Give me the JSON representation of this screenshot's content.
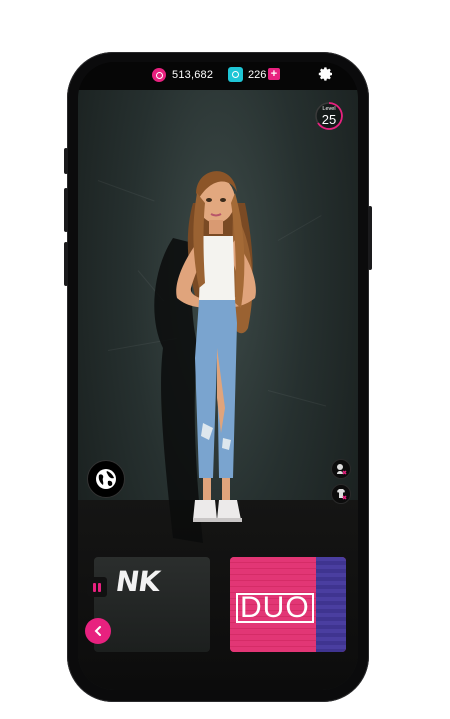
{
  "topbar": {
    "coins": "513,682",
    "gems": "226",
    "gem_plus": "+",
    "icons": {
      "coin": "coin-icon",
      "gem": "gem-icon",
      "settings": "gear-icon"
    }
  },
  "level": {
    "label": "Level",
    "value": "25"
  },
  "cards": [
    {
      "text": "NK"
    },
    {
      "text": "DUO"
    }
  ],
  "colors": {
    "accent": "#e8217f",
    "gem": "#1fc6d6",
    "duo_pink": "#e0316f",
    "duo_blue": "#4a3ea0"
  }
}
